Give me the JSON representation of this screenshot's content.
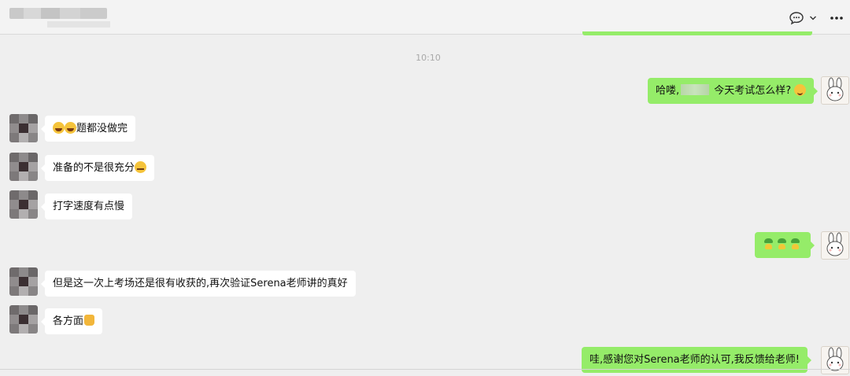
{
  "header": {
    "title": "",
    "icons": {
      "chat": "chat-bubble-icon",
      "chevron": "chevron-down-icon",
      "more": "more-icon"
    }
  },
  "timestamp": "10:10",
  "messages": [
    {
      "side": "right",
      "text_before": "哈喽,",
      "text_after": "今天考试怎么样?"
    },
    {
      "side": "left",
      "text": "题都没做完"
    },
    {
      "side": "left",
      "text": "准备的不是很充分"
    },
    {
      "side": "left",
      "text": "打字速度有点慢"
    },
    {
      "side": "right",
      "text": ""
    },
    {
      "side": "left",
      "text": "但是这一次上考场还是很有收获的,再次验证Serena老师讲的真好"
    },
    {
      "side": "left",
      "text": "各方面"
    },
    {
      "side": "right",
      "text": "哇,感谢您对Serena老师的认可,我反馈给老师!"
    }
  ],
  "colors": {
    "bubble_right": "#95ec69",
    "bubble_left": "#ffffff",
    "background": "#efefef"
  }
}
